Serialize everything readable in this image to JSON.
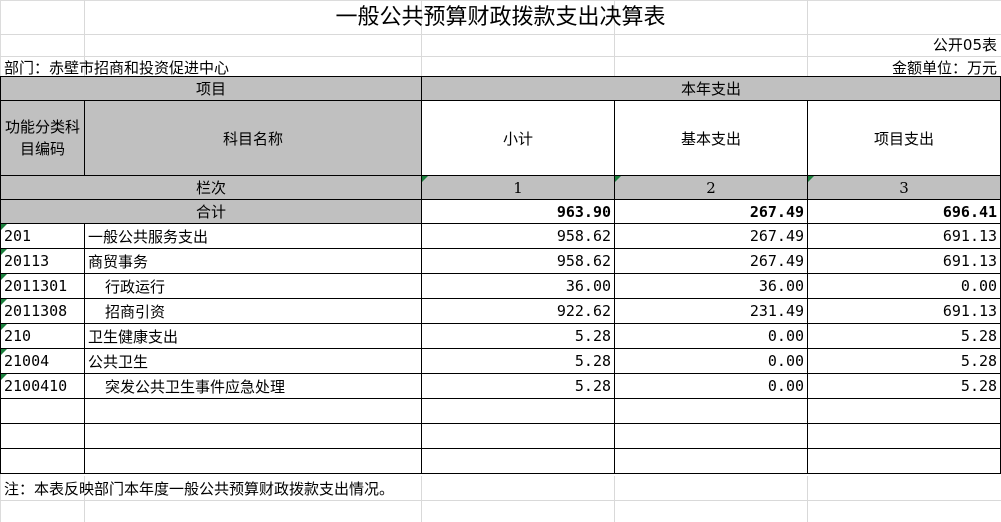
{
  "title": "一般公共预算财政拨款支出决算表",
  "form_no": "公开05表",
  "department": "部门：赤壁市招商和投资促进中心",
  "unit": "金额单位：万元",
  "header": {
    "group_left": "项目",
    "group_right": "本年支出",
    "code_col": "功能分类科目编码",
    "name_col": "科目名称",
    "subtotal": "小计",
    "basic": "基本支出",
    "project": "项目支出",
    "row_index_label": "栏次",
    "col_index": [
      "1",
      "2",
      "3"
    ],
    "total_label": "合计"
  },
  "totals": {
    "subtotal": "963.90",
    "basic": "267.49",
    "project": "696.41"
  },
  "rows": [
    {
      "code": "201",
      "name": "一般公共服务支出",
      "subtotal": "958.62",
      "basic": "267.49",
      "project": "691.13"
    },
    {
      "code": "20113",
      "name": "商贸事务",
      "subtotal": "958.62",
      "basic": "267.49",
      "project": "691.13"
    },
    {
      "code": "2011301",
      "name": "行政运行",
      "subtotal": "36.00",
      "basic": "36.00",
      "project": "0.00"
    },
    {
      "code": "2011308",
      "name": "招商引资",
      "subtotal": "922.62",
      "basic": "231.49",
      "project": "691.13"
    },
    {
      "code": "210",
      "name": "卫生健康支出",
      "subtotal": "5.28",
      "basic": "0.00",
      "project": "5.28"
    },
    {
      "code": "21004",
      "name": "公共卫生",
      "subtotal": "5.28",
      "basic": "0.00",
      "project": "5.28"
    },
    {
      "code": "2100410",
      "name": "突发公共卫生事件应急处理",
      "subtotal": "5.28",
      "basic": "0.00",
      "project": "5.28"
    }
  ],
  "note": "注：本表反映部门本年度一般公共预算财政拨款支出情况。"
}
